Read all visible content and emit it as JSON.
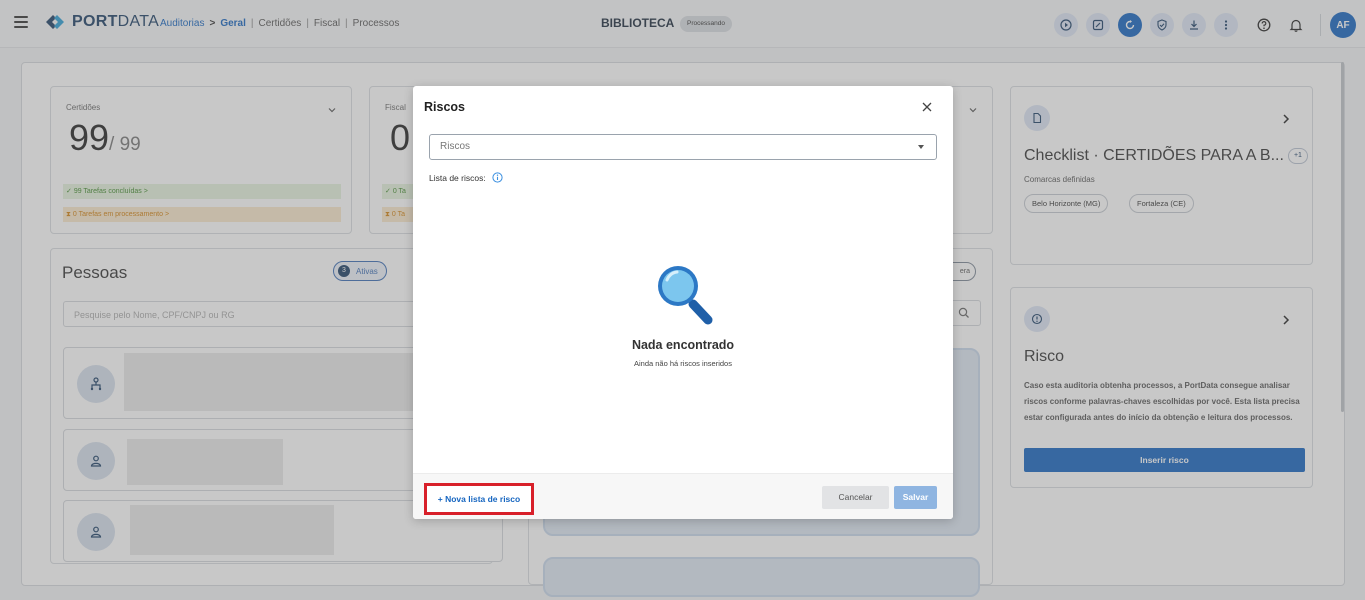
{
  "header": {
    "brand": {
      "port": "PORT",
      "data": "DATA"
    },
    "breadcrumb": {
      "auditorias": "Auditorias",
      "arrow": ">",
      "geral": "Geral",
      "certidoes": "Certidões",
      "fiscal": "Fiscal",
      "processos": "Processos",
      "separator": "|"
    },
    "title": "BIBLIOTECA",
    "status": "Processando",
    "toolbar_icons": [
      "play-icon",
      "edit-icon",
      "refresh-icon",
      "shield-check-icon",
      "download-icon",
      "more-vertical-icon",
      "help-icon",
      "bell-icon"
    ],
    "user_initials": "AF",
    "accent_color": "#1565c0"
  },
  "certidoes_card": {
    "label": "Certidões",
    "value": "99",
    "total": "/ 99",
    "done": "99 Tarefas concluídas",
    "processing": "0 Tarefas em processamento",
    "arrow": ">"
  },
  "fiscal_card": {
    "label": "Fiscal",
    "value_partial": "0",
    "done_partial": "0 Ta",
    "processing_partial": "0 Ta"
  },
  "pessoas": {
    "title": "Pessoas",
    "active_count": "3",
    "active_label": "Ativas",
    "search_placeholder": "Pesquise pelo Nome, CPF/CNPJ ou RG"
  },
  "right_panel": {
    "espera_partial": "era"
  },
  "checklist": {
    "title": "Checklist · CERTIDÕES PARA A B...",
    "more_badge": "+1",
    "subtitle": "Comarcas definidas",
    "chips": [
      "Belo Horizonte (MG)",
      "Fortaleza (CE)"
    ]
  },
  "risco": {
    "title": "Risco",
    "description": "Caso esta auditoria obtenha processos, a PortData consegue analisar riscos conforme palavras-chaves escolhidas por você. Esta lista precisa estar configurada antes do início da obtenção e leitura dos processos.",
    "button": "Inserir risco"
  },
  "modal": {
    "title": "Riscos",
    "select_value": "Riscos",
    "list_label": "Lista de riscos:",
    "empty_title": "Nada encontrado",
    "empty_subtitle": "Ainda não há riscos inseridos",
    "new_list_button": "+ Nova lista de risco",
    "cancel_button": "Cancelar",
    "save_button": "Salvar",
    "highlight_color": "#d8202a"
  }
}
